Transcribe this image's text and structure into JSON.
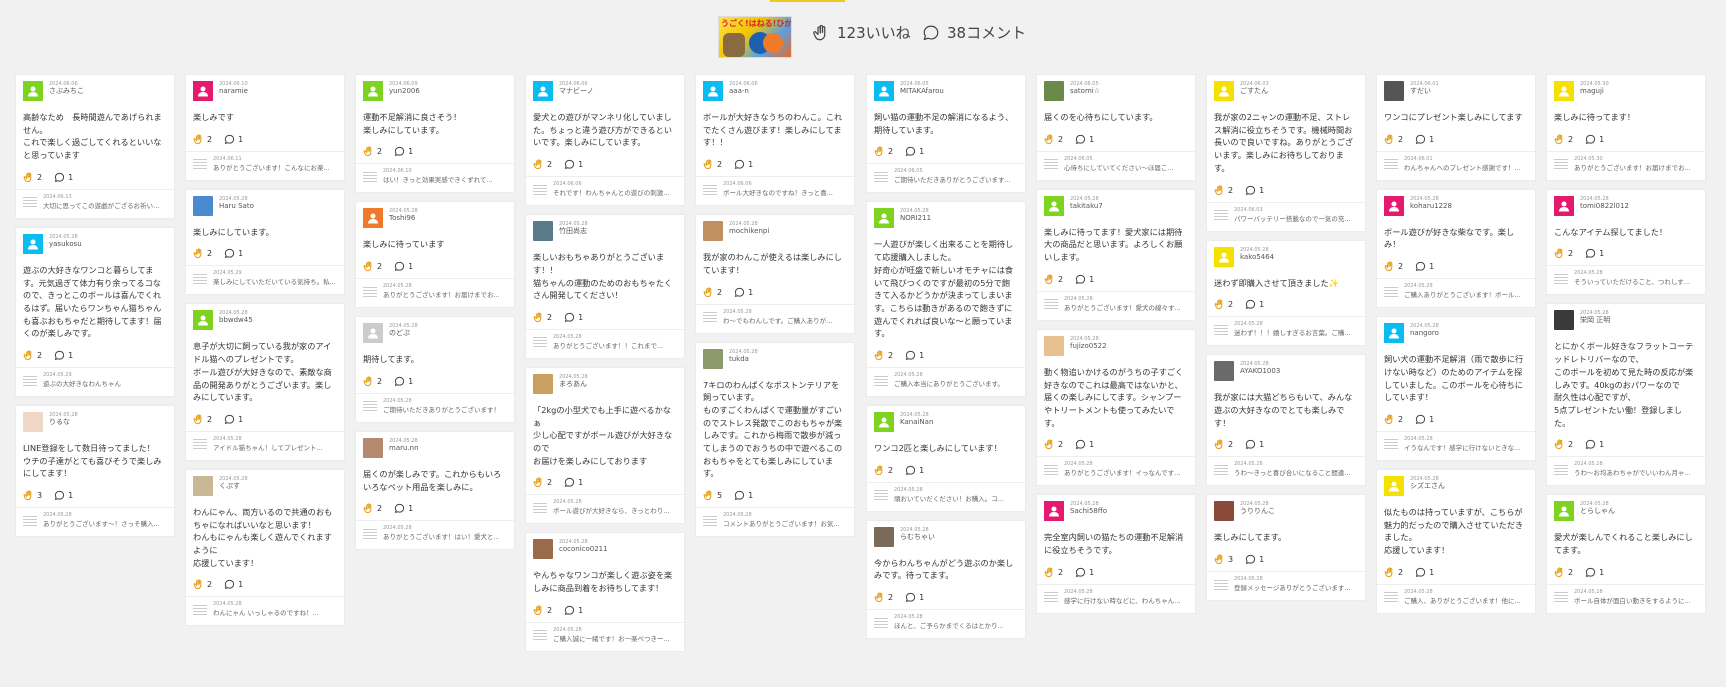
{
  "header": {
    "thumb_text": "うごく!はねる!ひかる!",
    "likes": "123いいね",
    "comments": "38コメント"
  },
  "columns": [
    [
      {
        "avatar": "plain",
        "color": "#7ed321",
        "date": "2024.06.06",
        "name": "さぶみちこ",
        "text": "高齢なため　長時間遊んであげられません。\nこれで楽しく過ごしてくれるといいなと思っています",
        "likes": "2",
        "com": "1",
        "reply_date": "2024.06.13",
        "reply": "大切に思ってこの遊戯がござるお祈い..."
      },
      {
        "avatar": "plain",
        "color": "#0bbcf0",
        "date": "2024.05.28",
        "name": "yasukosu",
        "text": "遊ぶの大好きなワンコと暮らしてます。元気過ぎて体力有り余ってるコなので、きっとこのボールは喜んでくれるはず。届いたらワンちゃん猫ちゃんも喜ぶおもちゃだと期待してます！届くのが楽しみです。",
        "likes": "2",
        "com": "1",
        "reply_date": "2024.05.29",
        "reply": "遊ぶの大好きなわんちゃん"
      },
      {
        "avatar": "photo",
        "color": "#f0d7c6",
        "date": "2024.05.28",
        "name": "りるな",
        "text": "LINE登録をして数日待ってました！\nウチの子達がとても喜びそうで楽しみにしてます！",
        "likes": "3",
        "com": "1",
        "reply_date": "2024.05.28",
        "reply": "ありがとうございます〜！さっそ購入..."
      }
    ],
    [
      {
        "avatar": "plain",
        "color": "#e5196d",
        "date": "2024.06.10",
        "name": "naramie",
        "text": "楽しみです",
        "likes": "2",
        "com": "1",
        "reply_date": "2024.06.11",
        "reply": "ありがとうございます！こんなにお楽..."
      },
      {
        "avatar": "photo",
        "color": "#4a8ad0",
        "date": "2024.05.28",
        "name": "Haru Sato",
        "text": "楽しみにしています。",
        "likes": "2",
        "com": "1",
        "reply_date": "2024.05.29",
        "reply": "楽しみにしていただいている気持ち。私..."
      },
      {
        "avatar": "plain",
        "color": "#7ed321",
        "date": "2024.05.28",
        "name": "bbwdw45",
        "text": "息子が大切に飼っている我が家のアイドル猫へのプレゼントです。\nボール遊びが大好きなので、素敵な商品の開発ありがとうございます。楽しみにしています。",
        "likes": "2",
        "com": "1",
        "reply_date": "2024.05.28",
        "reply": "アイドル猫ちゃん！してプレゼント..."
      },
      {
        "avatar": "photo",
        "color": "#c9b896",
        "date": "2024.05.28",
        "name": "くぷす",
        "text": "わんにゃん、両方いるので共通のおもちゃになればいいなと思います！\nわんもにゃんも楽しく遊んでくれますように\n応援しています！",
        "likes": "2",
        "com": "1",
        "reply_date": "2024.05.28",
        "reply": "わんにゃん いっしゃるのですね！..."
      }
    ],
    [
      {
        "avatar": "plain",
        "color": "#7ed321",
        "date": "2024.06.09",
        "name": "yun2006",
        "text": "運動不足解消に良さそう！\n楽しみにしています。",
        "likes": "2",
        "com": "1",
        "reply_date": "2024.06.10",
        "reply": "はい！きっと効果実感できくずれて..."
      },
      {
        "avatar": "plain",
        "color": "#f07a2a",
        "date": "2024.05.28",
        "name": "Toshi96",
        "text": "楽しみに待っています",
        "likes": "2",
        "com": "1",
        "reply_date": "2024.05.28",
        "reply": "ありがとうございます！お届けまでお..."
      },
      {
        "avatar": "plain",
        "color": "#cccccc",
        "date": "2024.05.28",
        "name": "のどぷ",
        "text": "期待してます。",
        "likes": "2",
        "com": "1",
        "reply_date": "2024.05.28",
        "reply": "ご期待いただきありがとうございます！"
      },
      {
        "avatar": "photo",
        "color": "#b38a70",
        "date": "2024.05.28",
        "name": "maru.nn",
        "text": "届くのが楽しみです。これからもいろいろなペット用品を楽しみに。",
        "likes": "2",
        "com": "1",
        "reply_date": "2024.05.28",
        "reply": "ありがとうございます！はい！愛犬と..."
      }
    ],
    [
      {
        "avatar": "plain",
        "color": "#0bbcf0",
        "date": "2024.06.06",
        "name": "マナビーノ",
        "text": "愛犬との遊びがマンネリ化していました。ちょっと違う遊び方ができるといいです。楽しみにしています。",
        "likes": "2",
        "com": "1",
        "reply_date": "2024.06.06",
        "reply": "それです！わんちゃんとの遊びの刺激..."
      },
      {
        "avatar": "photo",
        "color": "#5a7a8a",
        "date": "2024.05.28",
        "name": "竹田尚志",
        "text": "楽しいおもちゃありがとうございます！！\n猫ちゃんの運動のためのおもちゃたくさん開発してください！",
        "likes": "2",
        "com": "1",
        "reply_date": "2024.05.28",
        "reply": "ありがとうございます！！これまで..."
      },
      {
        "avatar": "photo",
        "color": "#c8a060",
        "date": "2024.05.28",
        "name": "まろあん",
        "text": "「2kgの小型犬でも上手に遊べるかなぁ\n少し心配ですがボール遊びが大好きなので\nお届けを楽しみにしております",
        "likes": "2",
        "com": "1",
        "reply_date": "2024.05.28",
        "reply": "ボール遊びが大好きなら、きっとわり..."
      },
      {
        "avatar": "photo",
        "color": "#9a6a4a",
        "date": "2024.05.28",
        "name": "coconico0211",
        "text": "やんちゃなワンコが楽しく遊ぶ姿を楽しみに商品到着をお待ちしてます！",
        "likes": "2",
        "com": "1",
        "reply_date": "2024.05.28",
        "reply": "ご購入誠に一緒です！お一楽べつきー..."
      }
    ],
    [
      {
        "avatar": "plain",
        "color": "#0bbcf0",
        "date": "2024.06.06",
        "name": "aaa-n",
        "text": "ボールが大好きなうちのわんこ。これでたくさん遊びます！楽しみにしてます！！",
        "likes": "2",
        "com": "1",
        "reply_date": "2024.06.06",
        "reply": "ボール大好きなのですね！きっと喜..."
      },
      {
        "avatar": "photo",
        "color": "#c09060",
        "date": "2024.05.28",
        "name": "mochikenpi",
        "text": "我が家のわんこが使えるは楽しみにしています！",
        "likes": "2",
        "com": "1",
        "reply_date": "2024.05.28",
        "reply": "わ〜でもわんしです。ご購入ありが..."
      },
      {
        "avatar": "photo",
        "color": "#8a9a6a",
        "date": "2024.05.28",
        "name": "tukda",
        "text": "7キロのわんぱくなボストンテリアを飼っています。\nものすごくわんぱくで運動量がすごいのでストレス発散でこのおもちゃが楽しみです。これから梅雨で散歩が減ってしまうのでおうちの中で遊べるこのおもちゃをとても楽しみにしています。",
        "likes": "5",
        "com": "1",
        "reply_date": "2024.05.28",
        "reply": "コメントありがとうございます！お気..."
      }
    ],
    [
      {
        "avatar": "plain",
        "color": "#0bbcf0",
        "date": "2024.06.05",
        "name": "MITAKAfarou",
        "text": "飼い猫の運動不足の解消になるよう、期待しています。",
        "likes": "2",
        "com": "1",
        "reply_date": "2024.06.05",
        "reply": "ご期待いただきありがとうございます..."
      },
      {
        "avatar": "plain",
        "color": "#7ed321",
        "date": "2024.05.28",
        "name": "NORI211",
        "text": "一人遊びが楽しく出来ることを期待して応援購入しました。\n好奇心が旺盛で新しいオモチャには食いて飛びつくのですが最初の5分で飽きて入るかどうかが決まってしまいます。こちらは動きがあるので飽きずに遊んでくれれば良いな〜と願っています。",
        "likes": "2",
        "com": "1",
        "reply_date": "2024.05.28",
        "reply": "ご購入本当にありがとうございます。"
      },
      {
        "avatar": "plain",
        "color": "#7ed321",
        "date": "2024.05.28",
        "name": "KanaiNan",
        "text": "ワンコ2匹と楽しみにしています！",
        "likes": "2",
        "com": "1",
        "reply_date": "2024.05.28",
        "reply": "頑おいていだください！お購入。コ..."
      },
      {
        "avatar": "photo",
        "color": "#7a6a5a",
        "date": "2024.05.28",
        "name": "らむちゃい",
        "text": "今からわんちゃんがどう遊ぶのか楽しみです。待ってます。",
        "likes": "2",
        "com": "1",
        "reply_date": "2024.05.28",
        "reply": "ほんと、ご予らかまでくるはとかり..."
      }
    ],
    [
      {
        "avatar": "photo",
        "color": "#6a8a4a",
        "date": "2024.06.05",
        "name": "satomi☆",
        "text": "届くのを心待ちにしています。",
        "likes": "2",
        "com": "1",
        "reply_date": "2024.06.05",
        "reply": "心待ちにしていてください〜ほ届こ..."
      },
      {
        "avatar": "plain",
        "color": "#7ed321",
        "date": "2024.05.28",
        "name": "takitaku7",
        "text": "楽しみに待ってます！愛犬家には期待大の商品だと思います。よろしくお願いします。",
        "likes": "2",
        "com": "1",
        "reply_date": "2024.05.28",
        "reply": "ありがとうございます！愛犬の線々す..."
      },
      {
        "avatar": "photo",
        "color": "#e8c090",
        "date": "2024.05.28",
        "name": "fujizo0522",
        "text": "動く物追いかけるのがうちの子すごく好きなのでこれは最高ではないかと、届くの楽しみにしてます。シャンプーやトリートメントも使ってみたいです。",
        "likes": "2",
        "com": "1",
        "reply_date": "2024.05.28",
        "reply": "ありがとうございます！イっなんです..."
      },
      {
        "avatar": "plain",
        "color": "#e5196d",
        "date": "2024.05.28",
        "name": "Sachi58ffo",
        "text": "完全室内飼いの猫たちの運動不足解消に役立ちそうです。",
        "likes": "2",
        "com": "1",
        "reply_date": "2024.05.28",
        "reply": "感学に行けない時などに、わんちゃん..."
      }
    ],
    [
      {
        "avatar": "plain",
        "color": "#f5e000",
        "date": "2024.06.03",
        "name": "ごすたん",
        "text": "我が家の2ニャンの運動不足、ストレス解消に役立ちそうです。機械時間お長いので良いですね。ありがとうございます。楽しみにお待ちしております。",
        "likes": "2",
        "com": "1",
        "reply_date": "2024.06.03",
        "reply": "パワーバッテリー搭載なので一気の充..."
      },
      {
        "avatar": "plain",
        "color": "#f5e000",
        "date": "2024.05.28",
        "name": "kako5464",
        "text": "迷わず即購入させて頂きました✨",
        "likes": "2",
        "com": "1",
        "reply_date": "2024.05.28",
        "reply": "迷わず！！！嬉しすぎるお言葉。ご購..."
      },
      {
        "avatar": "photo",
        "color": "#6a6a6a",
        "date": "2024.05.28",
        "name": "AYAKO1003",
        "text": "我が家には大猫どちらもいて、みんな遊ぶの大好きなのでとても楽しみです！",
        "likes": "2",
        "com": "1",
        "reply_date": "2024.05.28",
        "reply": "うわ〜きっと喜び合いになること間違..."
      },
      {
        "avatar": "photo",
        "color": "#8a4a3a",
        "date": "2024.05.28",
        "name": "うりりんこ",
        "text": "楽しみにしてます。",
        "likes": "3",
        "com": "1",
        "reply_date": "2024.05.28",
        "reply": "登録メッセージありがとうございます..."
      }
    ],
    [
      {
        "avatar": "photo",
        "color": "#555555",
        "date": "2024.06.01",
        "name": "すだい",
        "text": "ワンコにプレゼント楽しみにしてます",
        "likes": "2",
        "com": "1",
        "reply_date": "2024.06.01",
        "reply": "わんちゃんへのプレゼント感謝です！..."
      },
      {
        "avatar": "plain",
        "color": "#e5196d",
        "date": "2024.05.28",
        "name": "koharu1228",
        "text": "ボール遊びが好きな柴なです。楽しみ！",
        "likes": "2",
        "com": "1",
        "reply_date": "2024.05.28",
        "reply": "ご購入ありがとうございます！ボール..."
      },
      {
        "avatar": "plain",
        "color": "#0bbcf0",
        "date": "2024.05.28",
        "name": "nangoro",
        "text": "飼い犬の運動不足解消（雨で散歩に行けない時など）のためのアイテムを探していました。このボールを心待ちにしています！",
        "likes": "2",
        "com": "1",
        "reply_date": "2024.05.28",
        "reply": "イうなんです！感学に行けないときな..."
      },
      {
        "avatar": "plain",
        "color": "#f5e000",
        "date": "2024.05.28",
        "name": "シズエさん",
        "text": "似たものは持っていますが、こちらが魅力的だったので購入させていただきました。\n応援しています！",
        "likes": "2",
        "com": "1",
        "reply_date": "2024.05.28",
        "reply": "ご購入、ありがとうございます！他に..."
      }
    ],
    [
      {
        "avatar": "plain",
        "color": "#f5e000",
        "date": "2024.05.30",
        "name": "maguji",
        "text": "楽しみに待ってます！",
        "likes": "2",
        "com": "1",
        "reply_date": "2024.05.30",
        "reply": "ありがとうございます！お届けまでお..."
      },
      {
        "avatar": "plain",
        "color": "#e5196d",
        "date": "2024.05.28",
        "name": "tomi0822l012",
        "text": "こんなアイテム探してました！",
        "likes": "2",
        "com": "1",
        "reply_date": "2024.05.28",
        "reply": "そういっていただけること、つれしす..."
      },
      {
        "avatar": "photo",
        "color": "#3a3a3a",
        "date": "2024.05.28",
        "name": "栄岡 正明",
        "text": "とにかくボール好きなフラットコーテッドレトリバーなので、\nこのボールを初めて見た時の反応が楽しみです。40kgのおパワーなので\n耐久性は心配ですが、\n5点プレゼントたい働！登録しました。",
        "likes": "2",
        "com": "1",
        "reply_date": "2024.05.28",
        "reply": "うわ〜お均あわちゃがでいいわん月ゃ..."
      },
      {
        "avatar": "plain",
        "color": "#7ed321",
        "date": "2024.05.28",
        "name": "とらしゃん",
        "text": "愛犬が楽しんでくれること楽しみにしてます。",
        "likes": "2",
        "com": "1",
        "reply_date": "2024.05.28",
        "reply": "ボール自体が面白い動きをするように..."
      }
    ]
  ]
}
